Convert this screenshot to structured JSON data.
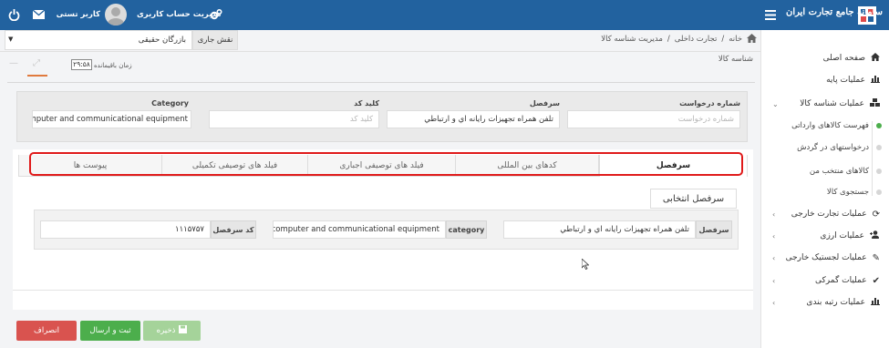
{
  "header": {
    "logo_text": "سامانه جامع تجارت ایران",
    "menu_icon": "hamburger-icon",
    "user_account_label": "مدیریت حساب کاربری",
    "user_name": "کاربر تستی",
    "colors": {
      "topbar": "#22629f",
      "accent_green": "#4cae4c",
      "danger": "#d9534f"
    }
  },
  "role": {
    "label": "نقش جاری",
    "value": "بازرگان حقیقی"
  },
  "breadcrumb": {
    "home": "خانه",
    "level1": "تجارت داخلی",
    "level2": "مدیریت شناسه کالا"
  },
  "page": {
    "title": "شناسه کالا",
    "timer_label": "زمان باقیمانده",
    "timer_value": "۲۹:۵۸"
  },
  "request": {
    "number_label": "شماره درخواست",
    "number_placeholder": "شماره درخواست",
    "heading_label": "سرفصل",
    "heading_value": "تلفن همراه تجهیزات رایانه اي و ارتباطي",
    "key_label": "کلید کد",
    "key_placeholder": "کلید کد",
    "category_label": "Category",
    "category_value": "computer and communicational equipment"
  },
  "tabs": [
    {
      "label": "سرفصل"
    },
    {
      "label": "کدهای بین المللی"
    },
    {
      "label": "فیلد های توصیفی اجباری"
    },
    {
      "label": "فیلد های توصیفی تکمیلی"
    },
    {
      "label": "پیوست ها"
    }
  ],
  "selected_heading": {
    "legend": "سرفصل انتخابی",
    "heading_label": "سرفصل",
    "heading_value": "تلفن همراه تجهیزات رایانه اي و ارتباطي",
    "category_label": "category",
    "category_value": "computer and communicational equipment",
    "code_label": "کد سرفصل",
    "code_value": "۱۱۱۵۷۵۷"
  },
  "actions": {
    "save": "ذخیره",
    "submit": "ثبت و ارسال",
    "cancel": "انصراف"
  },
  "sidebar": {
    "items": [
      {
        "label": "صفحه اصلی",
        "icon": "home-icon"
      },
      {
        "label": "عملیات پایه",
        "icon": "bar-chart-icon"
      },
      {
        "label": "عملیات شناسه کالا",
        "icon": "cubes-icon"
      },
      {
        "label": "عملیات تجارت خارجی",
        "icon": "refresh-icon"
      },
      {
        "label": "عملیات ارزی",
        "icon": "user-plus-icon"
      },
      {
        "label": "عملیات لجستیک خارجی",
        "icon": "edit-icon"
      },
      {
        "label": "عملیات گمرکی",
        "icon": "check-icon"
      },
      {
        "label": "عملیات رتبه بندی",
        "icon": "bar-chart-icon"
      }
    ],
    "subitems": [
      {
        "label": "فهرست کالاهای وارداتی"
      },
      {
        "label": "درخواستهای در گردش"
      },
      {
        "label": "کالاهای منتخب من"
      },
      {
        "label": "جستجوی کالا"
      }
    ]
  }
}
